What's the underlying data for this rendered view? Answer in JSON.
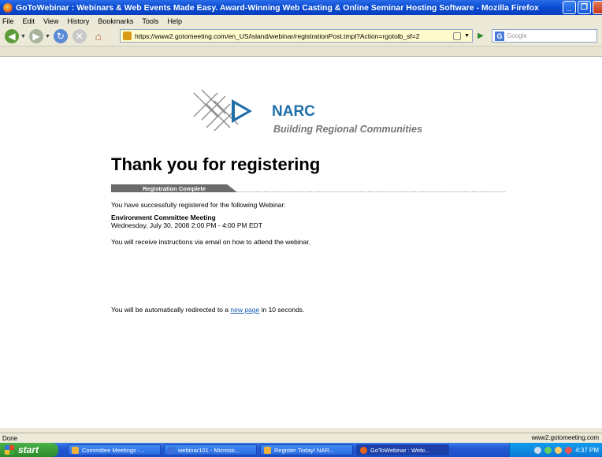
{
  "window": {
    "title": "GoToWebinar : Webinars & Web Events Made Easy. Award-Winning Web Casting & Online Seminar Hosting Software - Mozilla Firefox"
  },
  "menu": [
    "File",
    "Edit",
    "View",
    "History",
    "Bookmarks",
    "Tools",
    "Help"
  ],
  "nav": {
    "url": "https://www2.gotomeeting.com/en_US/island/webinar/registrationPost.tmpl?Action=rgotolb_sf=2",
    "search_placeholder": "Google"
  },
  "page": {
    "brand": "NARC",
    "tagline": "Building Regional Communities",
    "heading": "Thank you for registering",
    "tab_label": "Registration Complete",
    "registered_text": "You have successfully registered for the following Webinar:",
    "event_name": "Environment Committee Meeting",
    "event_time": "Wednesday, July 30, 2008 2:00 PM - 4:00 PM EDT",
    "instructions": "You will receive instructions via email on how to attend the webinar.",
    "redirect_prefix": "You will be automatically redirected to a ",
    "redirect_link": "new page",
    "redirect_suffix": " in 10 seconds."
  },
  "status": {
    "left": "Done",
    "right": "www2.gotomeeting.com"
  },
  "taskbar": {
    "start": "start",
    "tasks": [
      {
        "label": "Committee Meetings -...",
        "icon_color": "#f2b23a"
      },
      {
        "label": "webinar101 - Microso...",
        "icon_color": "#3a6fd8"
      },
      {
        "label": "Register Today! NAR...",
        "icon_color": "#f2b23a"
      },
      {
        "label": "GoToWebinar : Webi...",
        "icon_color": "#e8641a"
      }
    ],
    "clock": "4:37 PM"
  }
}
